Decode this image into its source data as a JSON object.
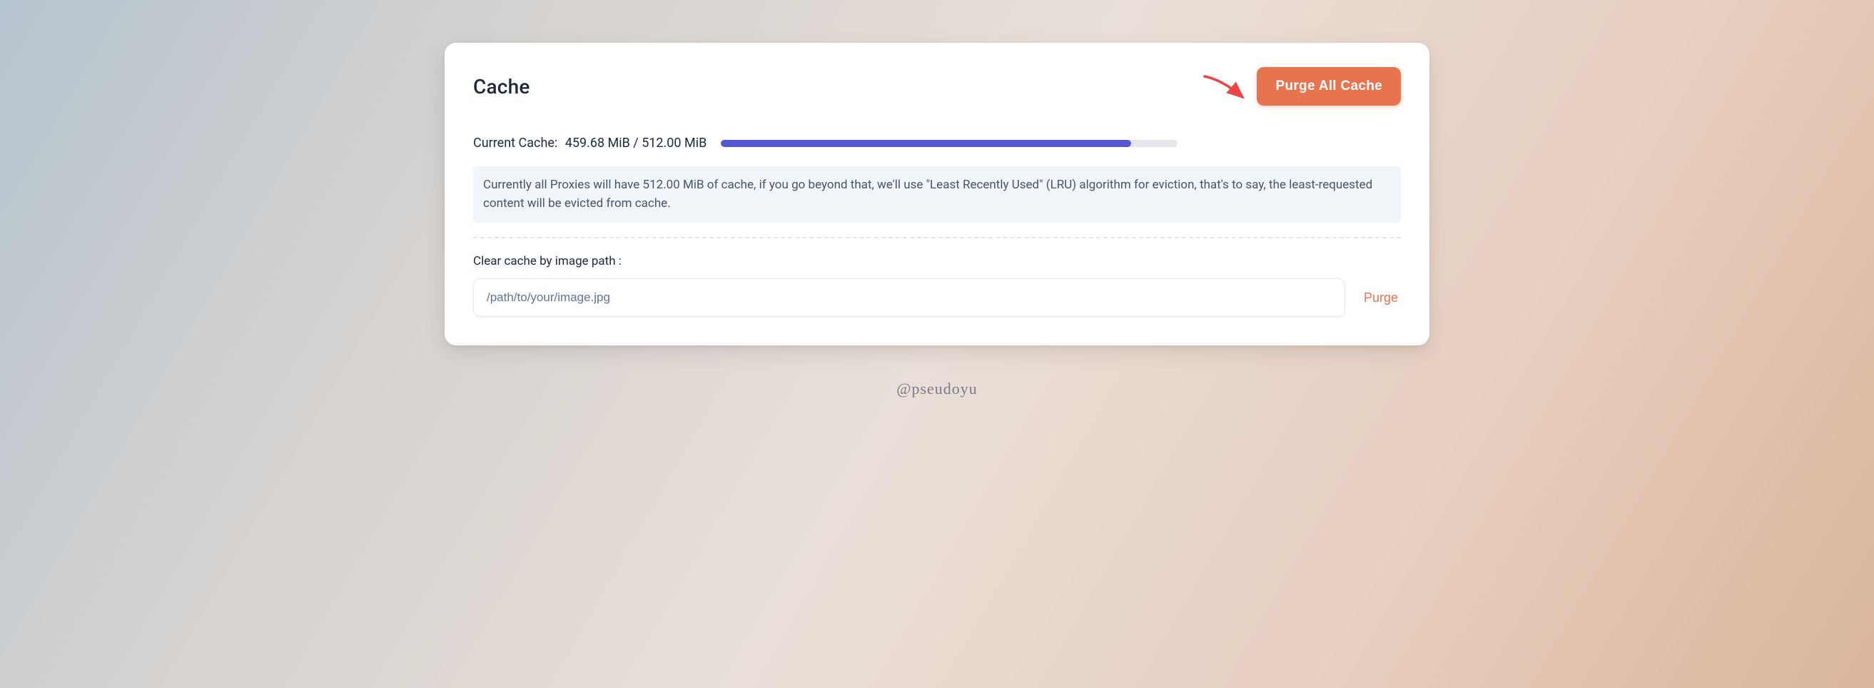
{
  "card": {
    "title": "Cache",
    "purge_all_label": "Purge All Cache"
  },
  "cache": {
    "label": "Current Cache:",
    "usage_text": "459.68 MiB / 512.00 MiB",
    "progress_percent": 89.78
  },
  "info": {
    "text": "Currently all Proxies will have 512.00 MiB of cache, if you go beyond that, we'll use \"Least Recently Used\" (LRU) algorithm for eviction, that's to say, the least-requested content will be evicted from cache."
  },
  "clear": {
    "label": "Clear cache by image path :",
    "placeholder": "/path/to/your/image.jpg",
    "purge_label": "Purge"
  },
  "watermark": "@pseudoyu",
  "colors": {
    "accent_orange": "#e8744f",
    "progress_fill": "#5457cf",
    "arrow": "#ef4444"
  }
}
